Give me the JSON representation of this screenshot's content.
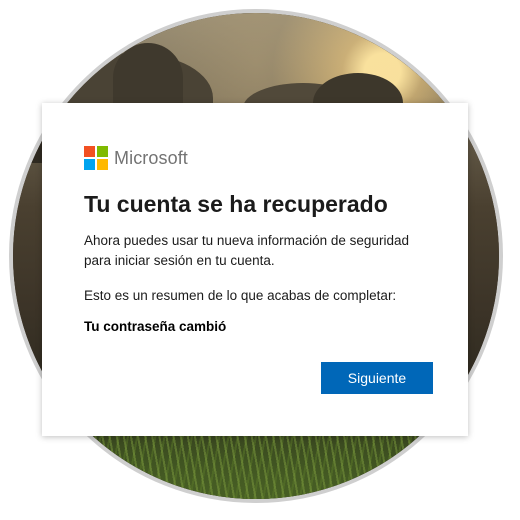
{
  "brand": {
    "name": "Microsoft",
    "logo_colors": [
      "#f25022",
      "#7fba00",
      "#00a4ef",
      "#ffb900"
    ]
  },
  "dialog": {
    "title": "Tu cuenta se ha recuperado",
    "description": "Ahora puedes usar tu nueva información de seguridad para iniciar sesión en tu cuenta.",
    "summary": "Esto es un resumen de lo que acabas de completar:",
    "change_item": "Tu contraseña cambió",
    "next_button_label": "Siguiente"
  },
  "colors": {
    "accent": "#0067b8",
    "text": "#1b1b1b",
    "brand_text": "#737373"
  }
}
